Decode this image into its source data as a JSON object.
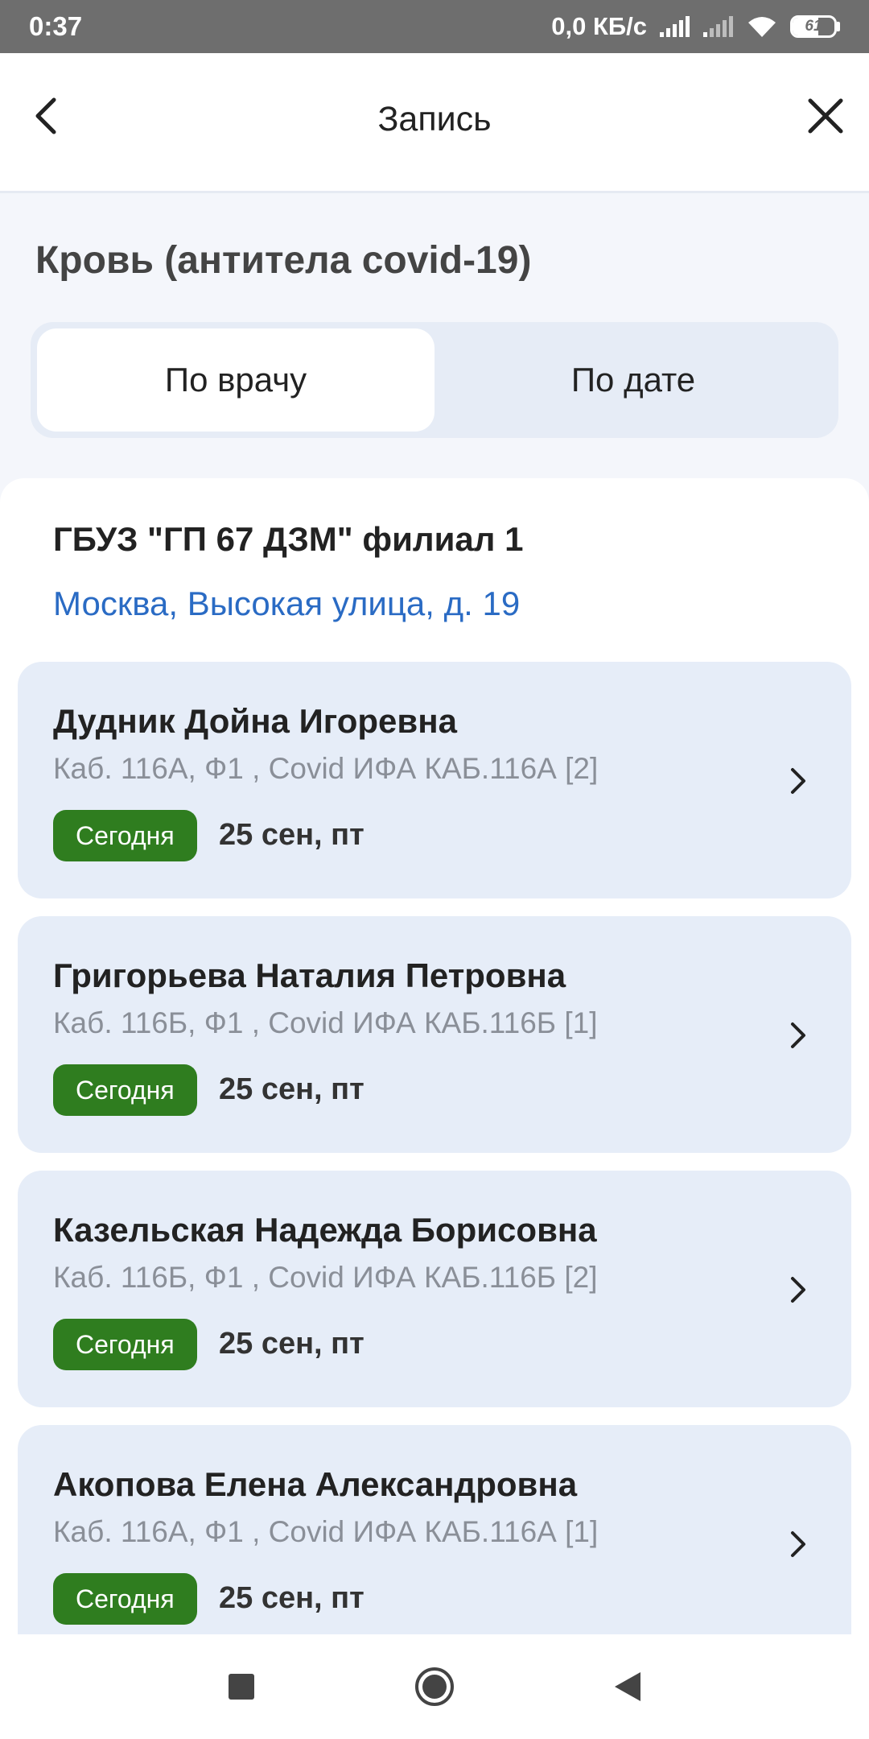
{
  "status_bar": {
    "time": "0:37",
    "speed": "0,0 КБ/с",
    "battery": "61",
    "battery_level": 0.61
  },
  "header": {
    "title": "Запись",
    "back_icon": "chevron-left-icon",
    "close_icon": "close-icon"
  },
  "service": {
    "title": "Кровь (антитела covid-19)"
  },
  "tabs": [
    {
      "label": "По врачу",
      "active": true
    },
    {
      "label": "По дате",
      "active": false
    }
  ],
  "clinic": {
    "name": "ГБУЗ \"ГП 67 ДЗМ\" филиал 1",
    "address": "Москва, Высокая улица, д. 19"
  },
  "doctors": [
    {
      "name": "Дудник Дойна Игоревна",
      "room": "Каб. 116А, Ф1 , Covid ИФА КАБ.116А [2]",
      "badge": "Сегодня",
      "date": "25 сен, пт"
    },
    {
      "name": "Григорьева Наталия Петровна",
      "room": "Каб. 116Б, Ф1 , Covid ИФА КАБ.116Б [1]",
      "badge": "Сегодня",
      "date": "25 сен, пт"
    },
    {
      "name": "Казельская Надежда Борисовна",
      "room": "Каб. 116Б, Ф1 , Covid ИФА КАБ.116Б [2]",
      "badge": "Сегодня",
      "date": "25 сен, пт"
    },
    {
      "name": "Акопова Елена Александровна",
      "room": "Каб. 116А, Ф1 , Covid ИФА КАБ.116А [1]",
      "badge": "Сегодня",
      "date": "25 сен, пт"
    }
  ],
  "colors": {
    "accent_link": "#2a6bc4",
    "badge_green": "#2f7d1f",
    "card_bg": "#e6edf8",
    "status_bar_bg": "#6e6e6e"
  },
  "nav": {
    "recent_icon": "square-icon",
    "home_icon": "circle-icon",
    "back_icon": "triangle-back-icon"
  }
}
